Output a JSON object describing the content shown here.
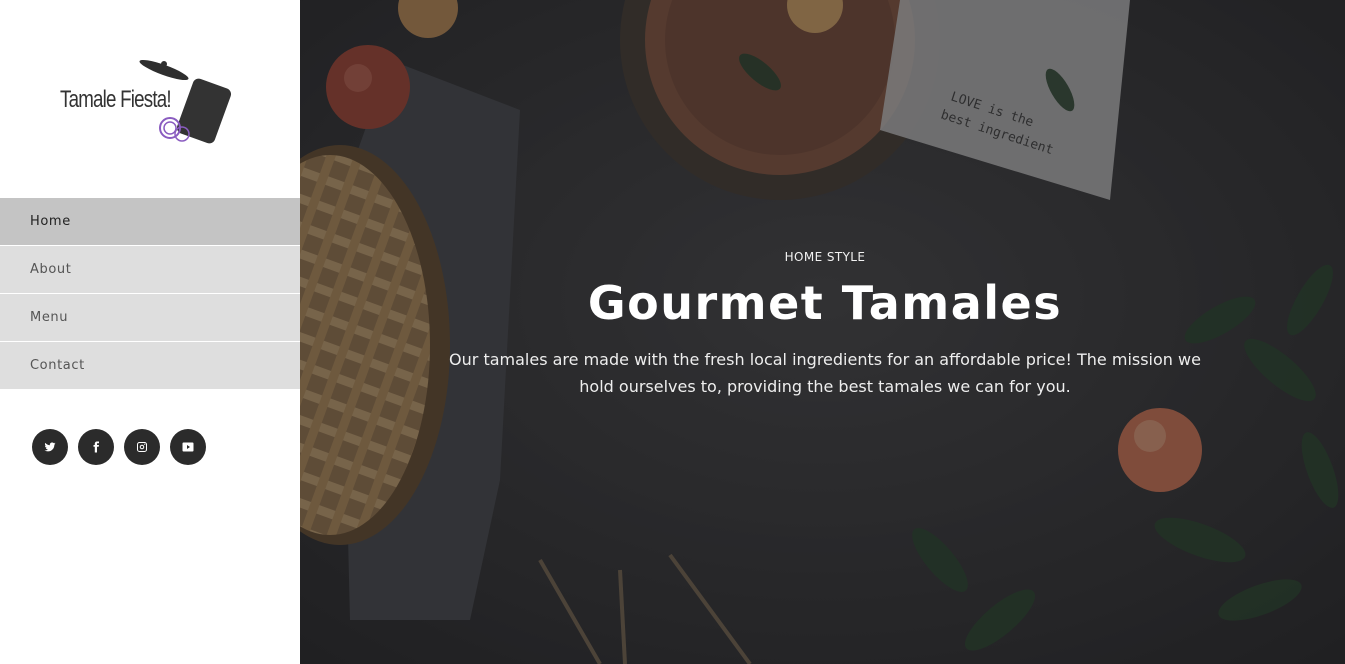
{
  "brand": {
    "name": "Tamale Fiesta!"
  },
  "nav": {
    "items": [
      {
        "label": "Home",
        "active": true
      },
      {
        "label": "About",
        "active": false
      },
      {
        "label": "Menu",
        "active": false
      },
      {
        "label": "Contact",
        "active": false
      }
    ]
  },
  "social": [
    {
      "name": "twitter-icon"
    },
    {
      "name": "facebook-icon"
    },
    {
      "name": "instagram-icon"
    },
    {
      "name": "youtube-icon"
    }
  ],
  "hero": {
    "kicker": "HOME STYLE",
    "title": "Gourmet Tamales",
    "description": "Our tamales are made with the fresh local ingredients for an affordable price! The mission we hold ourselves to, providing the best tamales we can for you.",
    "napkin_text_line1": "LOVE is the",
    "napkin_text_line2": "best ingredient"
  },
  "colors": {
    "nav_bg": "#dedede",
    "nav_active_bg": "#c4c4c4",
    "social_bg": "#2b2b2b",
    "hero_bg": "#2e2e30",
    "accent_purple": "#8a5cc0"
  }
}
